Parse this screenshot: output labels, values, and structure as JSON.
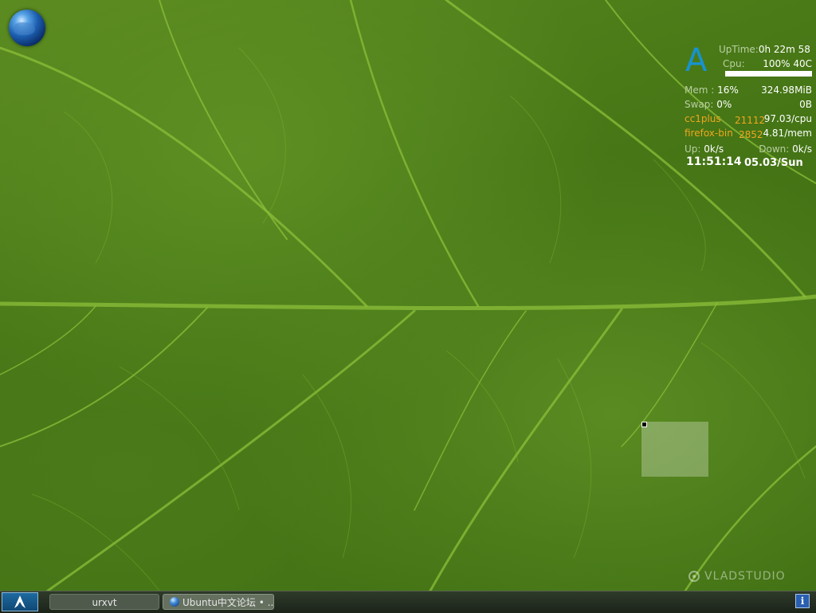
{
  "conky": {
    "logo": "A",
    "uptime_label": "UpTime:",
    "uptime_value": "0h 22m 58",
    "cpu_label": "Cpu:",
    "cpu_value": "100% 40C",
    "cpu_level": 1.0,
    "mem_label": "Mem :",
    "mem_percent": "16%",
    "mem_value": "324.98MiB",
    "swap_label": "Swap:",
    "swap_percent": "0%",
    "swap_value": "0B",
    "top_processes": [
      {
        "name": "cc1plus",
        "pid": "21112",
        "value": "97.03/cpu"
      },
      {
        "name": "firefox-bin",
        "pid": "2852",
        "value": "4.81/mem"
      }
    ],
    "up_label": "Up:",
    "up_value": "0k/s",
    "down_label": "Down:",
    "down_value": "0k/s",
    "time": "11:51:14",
    "date": "05.03/Sun"
  },
  "watermark": "VLADSTUDIO",
  "taskbar": {
    "tasks": [
      {
        "label": "urxvt"
      },
      {
        "label": "Ubuntu中文论坛 • ..."
      }
    ],
    "tray_info": "i"
  },
  "icons": {
    "desktop": "globe-icon",
    "start": "arch-logo-icon",
    "tray": "info-icon"
  },
  "colors": {
    "arch_blue": "#1793d1",
    "process_orange": "#f0a71f",
    "leaf_green": "#4a7a19"
  }
}
